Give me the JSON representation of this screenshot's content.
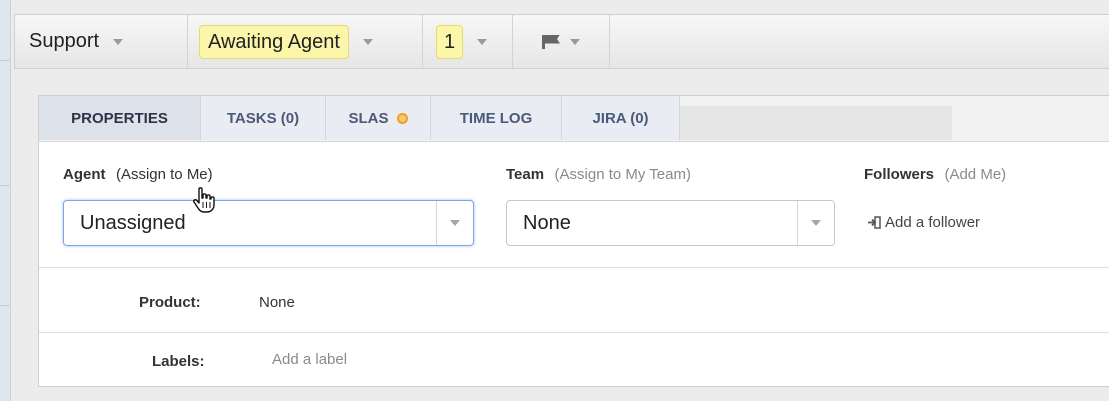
{
  "toolbar": {
    "department": "Support",
    "status": "Awaiting Agent",
    "urgency": "1",
    "flag_icon": "flag-icon"
  },
  "tabs": [
    {
      "label": "PROPERTIES",
      "active": true
    },
    {
      "label": "TASKS (0)"
    },
    {
      "label": "SLAS"
    },
    {
      "label": "TIME LOG"
    },
    {
      "label": "JIRA (0)"
    }
  ],
  "properties": {
    "agent": {
      "label": "Agent",
      "action": "(Assign to Me)",
      "value": "Unassigned"
    },
    "team": {
      "label": "Team",
      "action": "(Assign to My Team)",
      "value": "None"
    },
    "followers": {
      "label": "Followers",
      "action": "(Add Me)",
      "add_link": "Add a follower"
    },
    "product": {
      "label": "Product:",
      "value": "None"
    },
    "labels": {
      "label": "Labels:",
      "placeholder": "Add a label"
    }
  },
  "colors": {
    "status_pill_bg": "#fbf6a9",
    "tab_active_bg": "#dde2ea",
    "sla_dot": "#f0a020",
    "focus_border": "#7da6dd"
  }
}
